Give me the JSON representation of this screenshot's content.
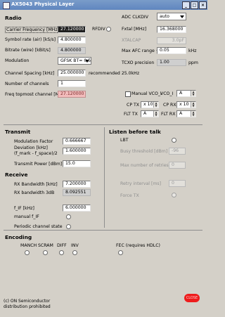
{
  "window": {
    "title": "AX5043 Physical Layer"
  },
  "radio": {
    "heading": "Radio",
    "carrier_label": "Carrier Frequency [MHz]",
    "carrier_value": "27.120000",
    "rfdiv_label": "RFDIV",
    "symbol_label": "Symbol rate (air) [kS/s]",
    "symbol_value": "4.800000",
    "bitrate_label": "Bitrate (wire) [kBit/s]",
    "bitrate_value": "4.800000",
    "modulation_label": "Modulation",
    "modulation_value": "GFSK BT= 0.5",
    "spacing_label": "Channel Spacing [kHz]",
    "spacing_value": "25.000000",
    "spacing_recommend": "recommended 25.0kHz",
    "channels_label": "Number of channels",
    "channels_value": "1",
    "topmost_label": "Freq topmost channel [MHz]",
    "topmost_value": "27.120000",
    "adc_label": "ADC CLKDIV",
    "adc_value": "auto",
    "fxtal_label": "Fxtal [MHz]",
    "fxtal_value": "16.368000",
    "xtalcap_label": "XTALCAP",
    "xtalcap_value": "3.0pF",
    "afc_label": "Max AFC range +/-",
    "afc_value": "0.05",
    "afc_unit": "kHz",
    "tcxo_label": "TCXO precision",
    "tcxo_value": "1.00",
    "tcxo_unit": "ppm",
    "manual_vco_label": "Manual VCO_I",
    "vco_i_label": "VCO_I",
    "vco_i_value": "A",
    "cp_tx_label": "CP TX",
    "cp_tx_value": "x 10",
    "cp_rx_label": "CP RX",
    "cp_rx_value": "x 10",
    "flt_tx_label": "FLT TX",
    "flt_tx_value": "A",
    "flt_rx_label": "FLT RX",
    "flt_rx_value": "A"
  },
  "transmit": {
    "heading": "Transmit",
    "mod_factor_label": "Modulation Factor",
    "mod_factor_value": "0.666667",
    "deviation_label": "Deviation [kHz]",
    "deviation_sub": "(f_mark - f_space)/2",
    "deviation_value": "1.600000",
    "power_label": "Transmit Power [dBm]",
    "power_value": "15.0"
  },
  "receive": {
    "heading": "Receive",
    "rxbw_label": "RX Bandwidth [kHz]",
    "rxbw_value": "7.200000",
    "rxbw3_label": "RX bandwidth 3dB",
    "rxbw3_value": "8.092551",
    "fif_label": "f_IF [kHz]",
    "fif_value": "6.000000",
    "manual_fif_label": "manual f_IF",
    "periodic_label": "Periodic channel state"
  },
  "lbt": {
    "heading": "Listen before talk",
    "lbt_label": "LBT",
    "busy_label": "Busy threshold [dBm]",
    "busy_value": "-96",
    "retries_label": "Max number of retries",
    "retries_value": "0",
    "retry_interval_label": "Retry interval [ms]",
    "retry_interval_value": "0",
    "force_tx_label": "Force TX"
  },
  "encoding": {
    "heading": "Encoding",
    "manch_label": "MANCH",
    "scram_label": "SCRAM",
    "diff_label": "DIFF",
    "inv_label": "INV",
    "fec_label": "FEC (requires HDLC)"
  },
  "footer": {
    "line1": "(c) ON Semiconductor",
    "line2": "distribution prohibited",
    "close_label": "CLOSE"
  },
  "colors": {
    "title_bar": "#6a8ec5",
    "close_button": "#ee1c1c",
    "window_bg": "#d4d0c8"
  }
}
